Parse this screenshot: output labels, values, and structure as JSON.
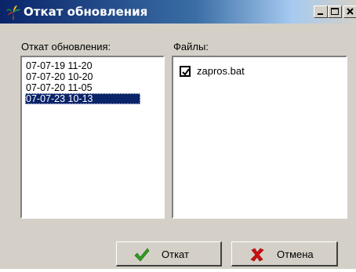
{
  "window": {
    "title": "Откат обновления",
    "icon": "tree-app-icon",
    "controls": [
      "minimize-icon",
      "maximize-icon",
      "close-icon"
    ]
  },
  "updates": {
    "label": "Откат обновления:",
    "items": [
      "07-07-19 11-20",
      "07-07-20 10-20",
      "07-07-20 11-05",
      "07-07-23 10-13"
    ],
    "selected_index": 3
  },
  "files": {
    "label": "Файлы:",
    "items": [
      {
        "name": "zapros.bat",
        "checked": true
      }
    ]
  },
  "buttons": {
    "rollback_label": "Откат",
    "rollback_icon": "checkmark-icon",
    "cancel_label": "Отмена",
    "cancel_icon": "cross-icon"
  },
  "colors": {
    "title_bar": "#0a246a",
    "selection": "#0a246a",
    "window_bg": "#d4d0c8",
    "check_green": "#2e9e1e",
    "cross_red": "#d01010"
  }
}
